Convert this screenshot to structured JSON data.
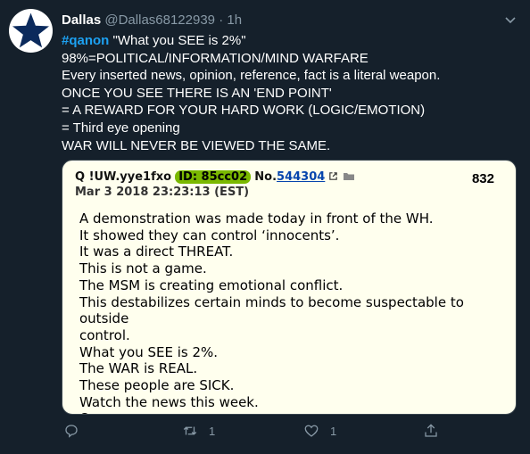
{
  "tweet": {
    "author_name": "Dallas",
    "author_handle": "@Dallas68122939",
    "separator": "·",
    "time": "1h",
    "hashtag": "#qanon",
    "first_line_rest": " \"What you SEE is 2%\"",
    "lines": [
      "98%=POLITICAL/INFORMATION/MIND WARFARE",
      "Every inserted news, opinion, reference, fact is a literal weapon.",
      "ONCE YOU SEE THERE IS AN 'END POINT'",
      "= A REWARD FOR YOUR HARD WORK (LOGIC/EMOTION)",
      "= Third eye opening",
      "WAR WILL NEVER BE VIEWED THE SAME."
    ]
  },
  "attached_post": {
    "poster": "Q !UW.yye1fxo",
    "id_label": "ID: 85cc02",
    "no_label": "No.",
    "post_number": "544304",
    "date": "Mar 3 2018 23:23:13 (EST)",
    "count": "832",
    "lines": [
      "A demonstration was made today in front of the WH.",
      "It showed they can control ‘innocents’.",
      "It was a direct THREAT.",
      "This is not a game.",
      "The MSM is creating emotional conflict.",
      "This destabilizes certain minds to become suspectable to outside",
      "control.",
      "What you SEE is 2%.",
      "The WAR is REAL.",
      "These people are SICK.",
      "Watch the news this week.",
      "Q"
    ]
  },
  "actions": {
    "reply_count": "",
    "retweet_count": "1",
    "like_count": "1",
    "share_count": ""
  },
  "colors": {
    "background": "#15202b",
    "accent": "#1da1f2",
    "muted": "#8899a6",
    "card": "#ffffee",
    "id_badge": "#7ab800"
  }
}
